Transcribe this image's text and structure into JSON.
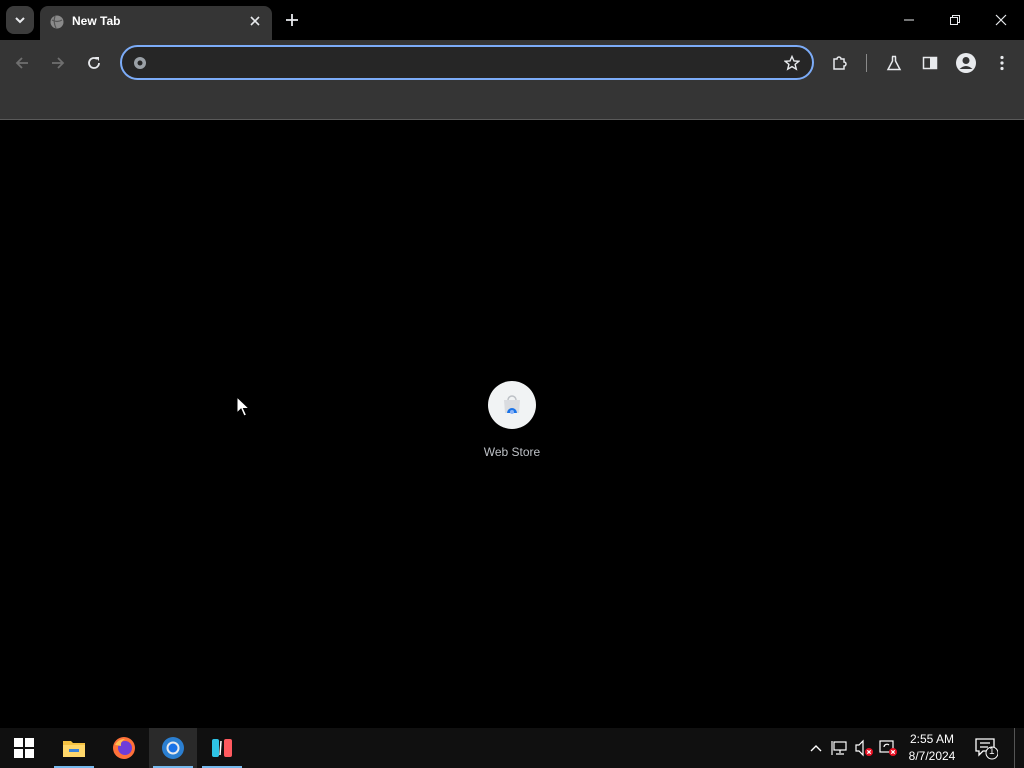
{
  "tab": {
    "title": "New Tab"
  },
  "omnibox": {
    "value": "",
    "placeholder": ""
  },
  "shortcuts": [
    {
      "label": "Web Store"
    }
  ],
  "taskbar": {
    "apps": [
      {
        "name": "start"
      },
      {
        "name": "file-explorer"
      },
      {
        "name": "firefox"
      },
      {
        "name": "chrome",
        "active": true
      },
      {
        "name": "editor"
      }
    ],
    "clock": {
      "time": "2:55 AM",
      "date": "8/7/2024"
    },
    "notification_count": "1"
  },
  "colors": {
    "accent": "#7cacf8",
    "toolbar": "#353535",
    "background": "#000000"
  }
}
